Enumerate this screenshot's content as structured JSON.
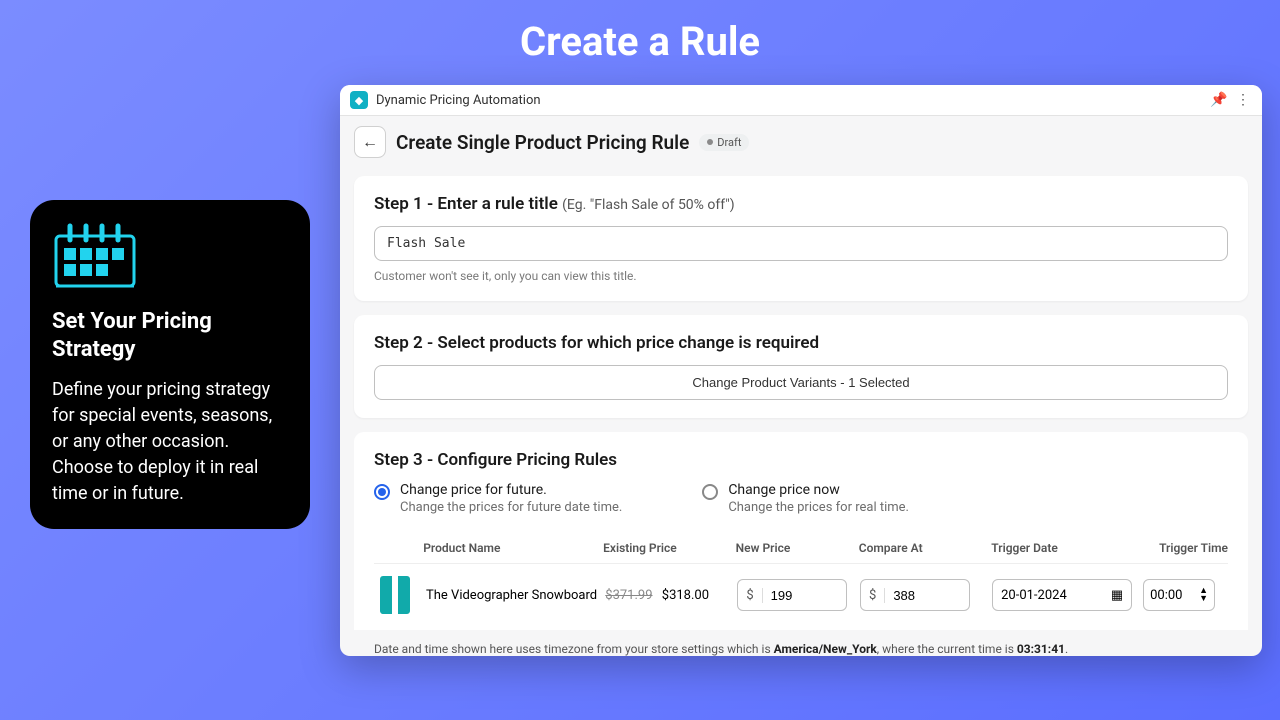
{
  "page": {
    "title": "Create a Rule"
  },
  "promo": {
    "heading": "Set Your Pricing Strategy",
    "description": "Define your pricing strategy for special events, seasons, or any other occasion. Choose to deploy it in real time or in future."
  },
  "app": {
    "name": "Dynamic Pricing Automation",
    "header": {
      "title": "Create Single Product Pricing Rule",
      "status": "Draft"
    },
    "step1": {
      "label": "Step 1 - Enter a rule title",
      "hint": "(Eg. \"Flash Sale of 50% off\")",
      "value": "Flash Sale",
      "helper": "Customer won't see it, only you can view this title."
    },
    "step2": {
      "label": "Step 2 - Select products for which price change is required",
      "button": "Change Product Variants - 1 Selected"
    },
    "step3": {
      "label": "Step 3 - Configure Pricing Rules",
      "options": [
        {
          "title": "Change price for future.",
          "sub": "Change the prices for future date time.",
          "selected": true
        },
        {
          "title": "Change price now",
          "sub": "Change the prices for real time.",
          "selected": false
        }
      ],
      "columns": {
        "product": "Product Name",
        "existing": "Existing Price",
        "new": "New Price",
        "compare": "Compare At",
        "trigdate": "Trigger Date",
        "trigtime": "Trigger Time"
      },
      "row": {
        "name": "The Videographer Snowboard",
        "old_price": "$371.99",
        "price": "$318.00",
        "currency": "$",
        "new_price": "199",
        "compare_at": "388",
        "trigger_date": "20-01-2024",
        "trigger_time": "00:00"
      },
      "tz": {
        "prefix": "Date and time shown here uses timezone from your store settings which is ",
        "zone": "America/New_York",
        "mid": ", where the current time is ",
        "time": "03:31:41",
        "suffix": "."
      }
    }
  }
}
